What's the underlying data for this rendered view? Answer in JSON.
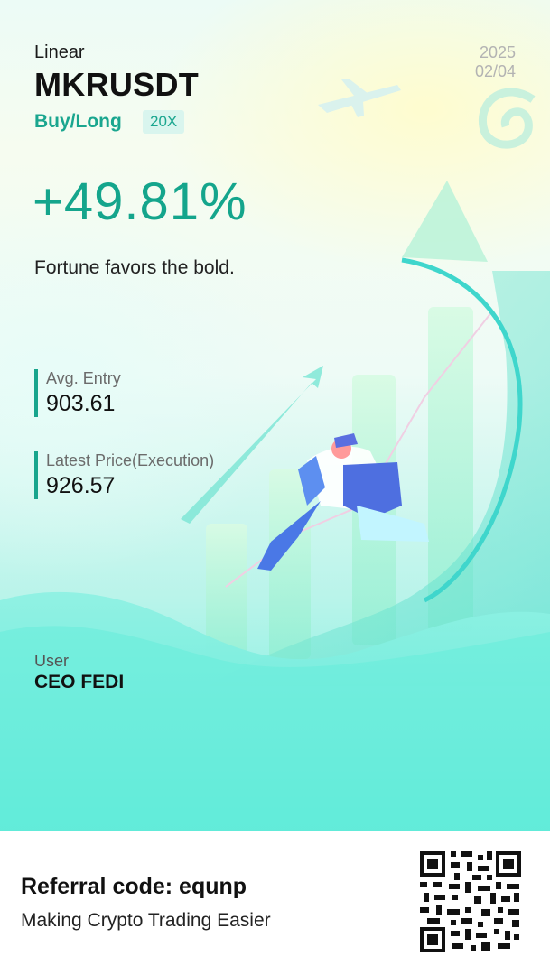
{
  "card": {
    "contract_type": "Linear",
    "symbol": "MKRUSDT",
    "side": "Buy/Long",
    "leverage": "20X",
    "date_year": "2025",
    "date_md": "02/04",
    "pnl_percent": "+49.81%",
    "slogan": "Fortune favors the bold.",
    "avg_entry_label": "Avg. Entry",
    "avg_entry_value": "903.61",
    "latest_price_label": "Latest Price(Execution)",
    "latest_price_value": "926.57",
    "user_label": "User",
    "user_name": "CEO FEDI"
  },
  "footer": {
    "referral": "Referral code: equnp",
    "tagline": "Making Crypto Trading Easier",
    "qr_icon": "qr-code-icon"
  },
  "colors": {
    "accent": "#14a58c",
    "background_top": "#ecfbf6",
    "background_bottom": "#62eedd",
    "footer_bg": "#ffffff"
  }
}
